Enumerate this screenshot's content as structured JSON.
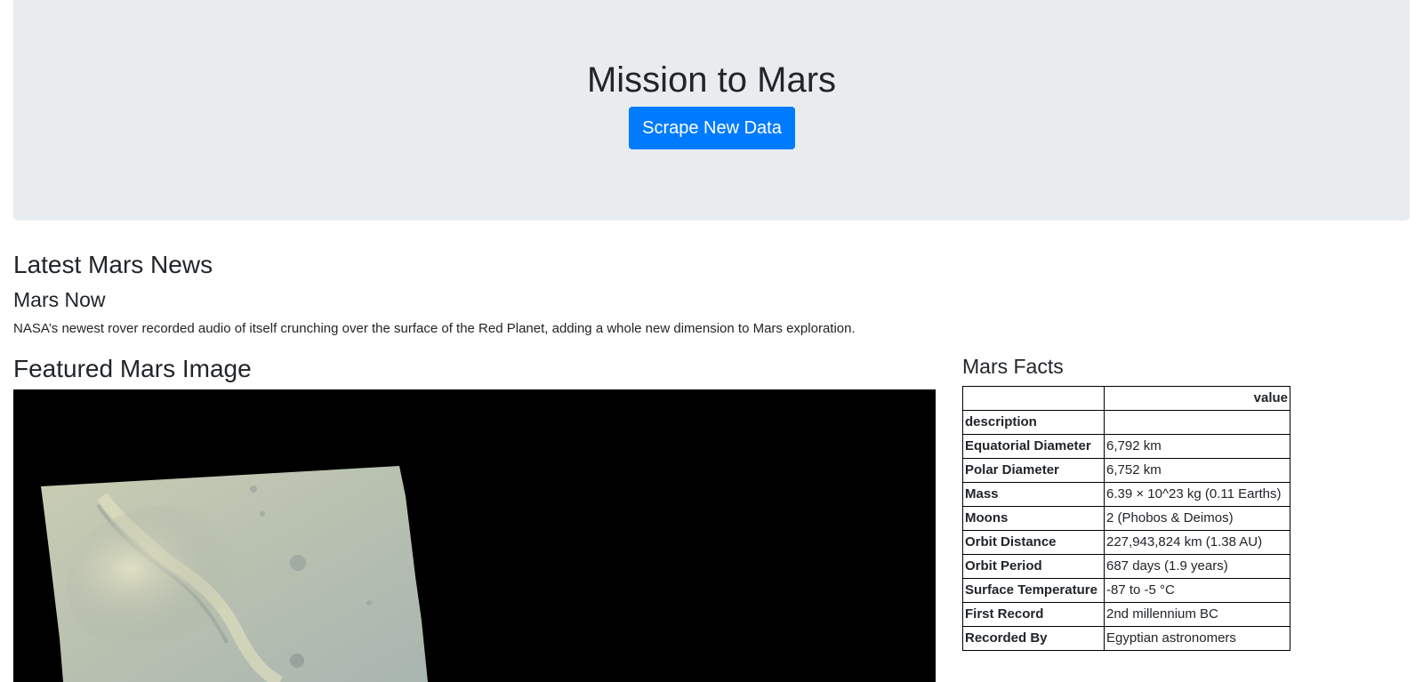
{
  "header": {
    "title": "Mission to Mars",
    "scrape_button": "Scrape New Data"
  },
  "news": {
    "heading": "Latest Mars News",
    "title": "Mars Now",
    "paragraph": "NASA’s newest rover recorded audio of itself crunching over the surface of the Red Planet, adding a whole new dimension to Mars exploration."
  },
  "featured_image": {
    "heading": "Featured Mars Image"
  },
  "facts": {
    "heading": "Mars Facts",
    "column_header": "value",
    "index_header": "description",
    "rows": [
      {
        "label": "Equatorial Diameter",
        "value": "6,792 km"
      },
      {
        "label": "Polar Diameter",
        "value": "6,752 km"
      },
      {
        "label": "Mass",
        "value": "6.39 × 10^23 kg (0.11 Earths)"
      },
      {
        "label": "Moons",
        "value": "2 (Phobos & Deimos)"
      },
      {
        "label": "Orbit Distance",
        "value": "227,943,824 km (1.38 AU)"
      },
      {
        "label": "Orbit Period",
        "value": "687 days (1.9 years)"
      },
      {
        "label": "Surface Temperature",
        "value": "-87 to -5 °C"
      },
      {
        "label": "First Record",
        "value": "2nd millennium BC"
      },
      {
        "label": "Recorded By",
        "value": "Egyptian astronomers"
      }
    ]
  }
}
